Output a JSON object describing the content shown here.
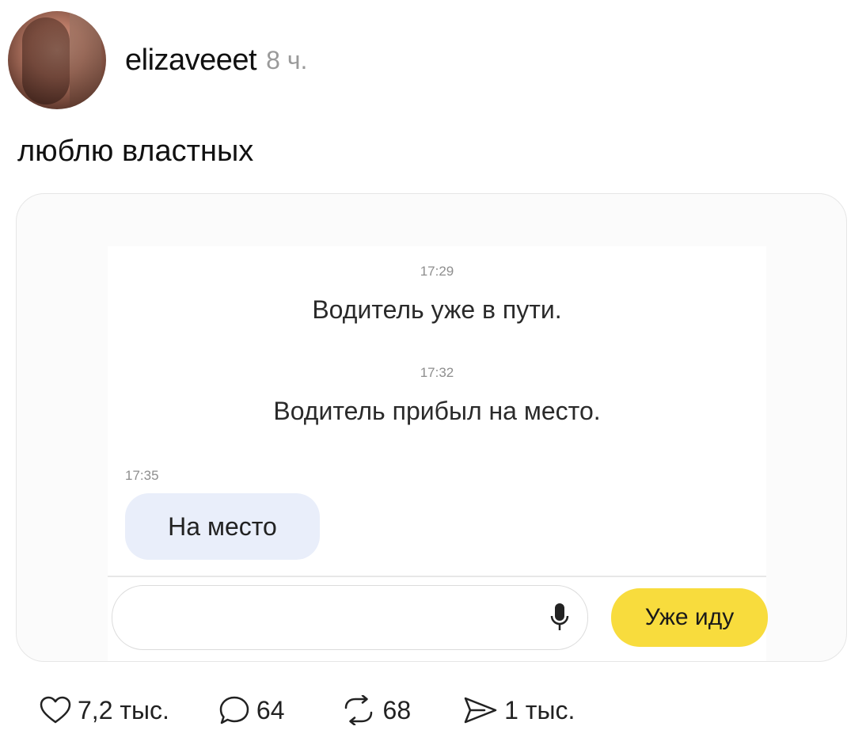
{
  "post": {
    "username": "elizaveeet",
    "time": "8 ч.",
    "text": "люблю властных"
  },
  "chat": {
    "events": [
      {
        "time": "17:29",
        "message": "Водитель уже в пути."
      },
      {
        "time": "17:32",
        "message": "Водитель прибыл на место."
      }
    ],
    "user_message": {
      "time": "17:35",
      "text": "На место"
    },
    "input_placeholder": "",
    "quick_reply": "Уже иду",
    "accent_color": "#f8dc3d",
    "bubble_color": "#e9eefa"
  },
  "actions": {
    "likes": "7,2 тыс.",
    "comments": "64",
    "reposts": "68",
    "shares": "1 тыс."
  },
  "icons": [
    "heart-icon",
    "comment-icon",
    "repost-icon",
    "share-icon",
    "microphone-icon"
  ]
}
